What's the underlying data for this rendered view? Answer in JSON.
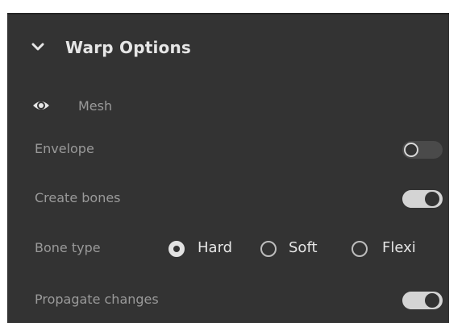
{
  "section": {
    "title": "Warp Options",
    "expanded": true
  },
  "mesh": {
    "label": "Mesh",
    "visible": true
  },
  "envelope": {
    "label": "Envelope",
    "enabled": false
  },
  "create_bones": {
    "label": "Create bones",
    "enabled": true
  },
  "bone_type": {
    "label": "Bone type",
    "options": [
      "Hard",
      "Soft",
      "Flexi"
    ],
    "selected": "Hard"
  },
  "propagate_changes": {
    "label": "Propagate changes",
    "enabled": true
  },
  "icons": {
    "section_toggle": "chevron-down-icon",
    "mesh_visibility": "eye-icon"
  },
  "colors": {
    "panel_background": "#333333",
    "label_text": "#9a9a9a",
    "title_text": "#e6e6e6",
    "toggle_on": "#d4d4d4",
    "toggle_off": "#4a4a4a"
  }
}
